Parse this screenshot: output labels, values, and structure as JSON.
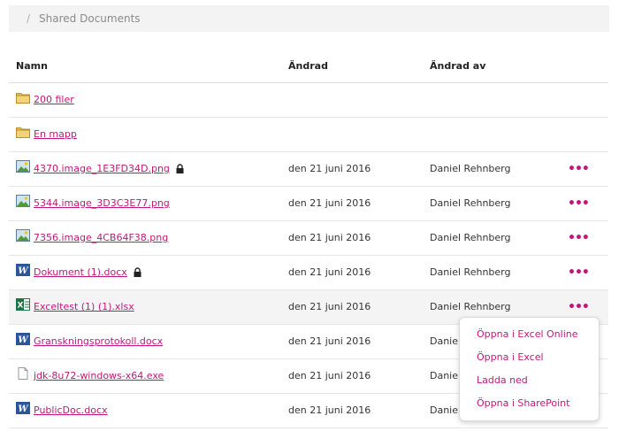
{
  "breadcrumb": {
    "separator": "/",
    "current": "Shared Documents"
  },
  "table": {
    "headers": {
      "name": "Namn",
      "modified": "Ändrad",
      "modified_by": "Ändrad av"
    },
    "rows": [
      {
        "icon": "folder-icon",
        "name": "200 filer",
        "modified": "",
        "modified_by": "",
        "menu": ""
      },
      {
        "icon": "folder-icon",
        "name": "En mapp",
        "modified": "",
        "modified_by": "",
        "menu": ""
      },
      {
        "icon": "image-file-icon",
        "name": "4370.image_1E3FD34D.png",
        "locked": true,
        "modified": "den 21 juni 2016",
        "modified_by": "Daniel Rehnberg",
        "menu": "•••"
      },
      {
        "icon": "image-file-icon",
        "name": "5344.image_3D3C3E77.png",
        "modified": "den 21 juni 2016",
        "modified_by": "Daniel Rehnberg",
        "menu": "•••"
      },
      {
        "icon": "image-file-icon",
        "name": "7356.image_4CB64F38.png",
        "modified": "den 21 juni 2016",
        "modified_by": "Daniel Rehnberg",
        "menu": "•••"
      },
      {
        "icon": "word-file-icon",
        "name": "Dokument (1).docx",
        "locked": true,
        "modified": "den 21 juni 2016",
        "modified_by": "Daniel Rehnberg",
        "menu": "•••"
      },
      {
        "icon": "excel-file-icon",
        "name": "Exceltest (1) (1).xlsx",
        "modified": "den 21 juni 2016",
        "modified_by": "Daniel Rehnberg",
        "menu": "•••"
      },
      {
        "icon": "word-file-icon",
        "name": "Granskningsprotokoll.docx",
        "modified": "den 21 juni 2016",
        "modified_by": "Danie",
        "menu": ""
      },
      {
        "icon": "generic-file-icon",
        "name": "jdk-8u72-windows-x64.exe",
        "modified": "den 21 juni 2016",
        "modified_by": "Danie",
        "menu": ""
      },
      {
        "icon": "word-file-icon",
        "name": "PublicDoc.docx",
        "modified": "den 21 juni 2016",
        "modified_by": "Danie",
        "menu": ""
      }
    ]
  },
  "context_menu": {
    "items": [
      "Öppna i Excel Online",
      "Öppna i Excel",
      "Ladda ned",
      "Öppna i SharePoint"
    ]
  },
  "colors": {
    "accent": "#c0187a",
    "breadcrumb_bg": "#f3f3f3",
    "row_highlight": "#f4f4f4"
  }
}
